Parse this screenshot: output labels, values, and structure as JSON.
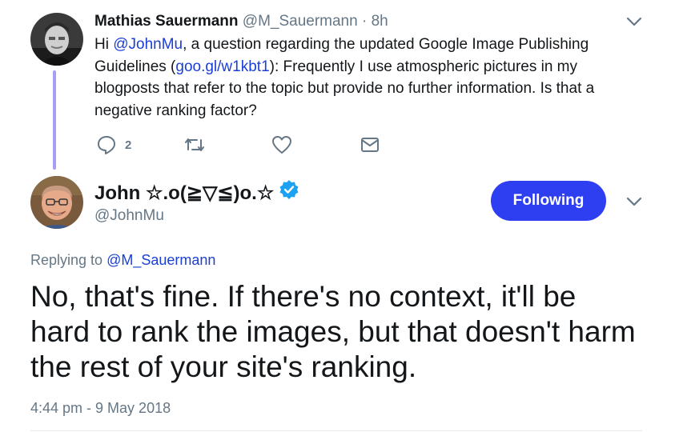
{
  "parent_tweet": {
    "name": "Mathias Sauermann",
    "handle": "@M_Sauermann",
    "separator": "·",
    "time": "8h",
    "text_parts": [
      "Hi ",
      "@JohnMu",
      ", a question regarding the updated Google Image Publishing Guidelines (",
      "goo.gl/w1kbt1",
      "): Frequently I use atmospheric pictures in my blogposts that refer to the topic but provide no further information. Is that a negative ranking factor?"
    ],
    "reply_count": "2"
  },
  "main_tweet": {
    "name": "John ☆.o(≧▽≦)o.☆",
    "handle": "@JohnMu",
    "follow_label": "Following",
    "replying_prefix": "Replying to ",
    "replying_to": "@M_Sauermann",
    "text": "No, that's fine. If there's no context, it'll be hard to rank the images, but that doesn't harm the rest of your site's ranking.",
    "timestamp": "4:44 pm - 9 May 2018"
  },
  "icons": {
    "parent_avatar": "avatar-photo",
    "main_avatar": "avatar-photo",
    "reply": "reply-icon",
    "retweet": "retweet-icon",
    "like": "heart-icon",
    "dm": "envelope-icon",
    "more": "chevron-down-icon",
    "verified": "verified-badge-icon"
  },
  "colors": {
    "accent": "#2e3ff2",
    "link": "#1b3fd6",
    "secondary_text": "#657786",
    "thread_line": "#a5a0f0",
    "verified": "#1da1f2"
  }
}
